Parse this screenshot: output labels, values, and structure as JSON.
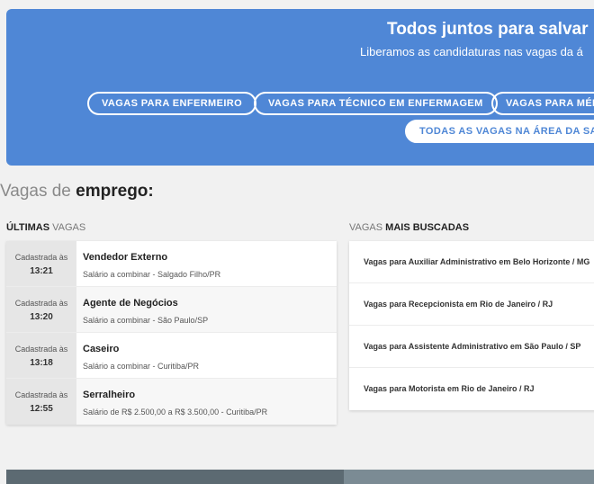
{
  "banner": {
    "title": "Todos juntos para salvar",
    "subtitle": "Liberamos as candidaturas nas vagas da á",
    "buttons": [
      "VAGAS PARA ENFERMEIRO",
      "VAGAS PARA TÉCNICO EM ENFERMAGEM",
      "VAGAS PARA MÉD"
    ],
    "all_button": "TODAS AS VAGAS NA ÁREA DA SAÚ"
  },
  "section": {
    "light": "Vagas de",
    "bold": "emprego:"
  },
  "latest": {
    "head_bold": "ÚLTIMAS",
    "head_light": "VAGAS",
    "jobs": [
      {
        "prefix": "Cadastrada às",
        "time": "13:21",
        "title": "Vendedor Externo",
        "detail": "Salário a combinar - Salgado Filho/PR"
      },
      {
        "prefix": "Cadastrada às",
        "time": "13:20",
        "title": "Agente de Negócios",
        "detail": "Salário a combinar - São Paulo/SP"
      },
      {
        "prefix": "Cadastrada às",
        "time": "13:18",
        "title": "Caseiro",
        "detail": "Salário a combinar - Curitiba/PR"
      },
      {
        "prefix": "Cadastrada às",
        "time": "12:55",
        "title": "Serralheiro",
        "detail": "Salário de R$ 2.500,00 a R$ 3.500,00 - Curitiba/PR"
      }
    ]
  },
  "searched": {
    "head_light": "VAGAS",
    "head_bold": "MAIS BUSCADAS",
    "items": [
      "Vagas para Auxiliar Administrativo em Belo Horizonte / MG",
      "Vagas para Recepcionista em Rio de Janeiro / RJ",
      "Vagas para Assistente Administrativo em São Paulo / SP",
      "Vagas para Motorista em Rio de Janeiro / RJ"
    ]
  }
}
